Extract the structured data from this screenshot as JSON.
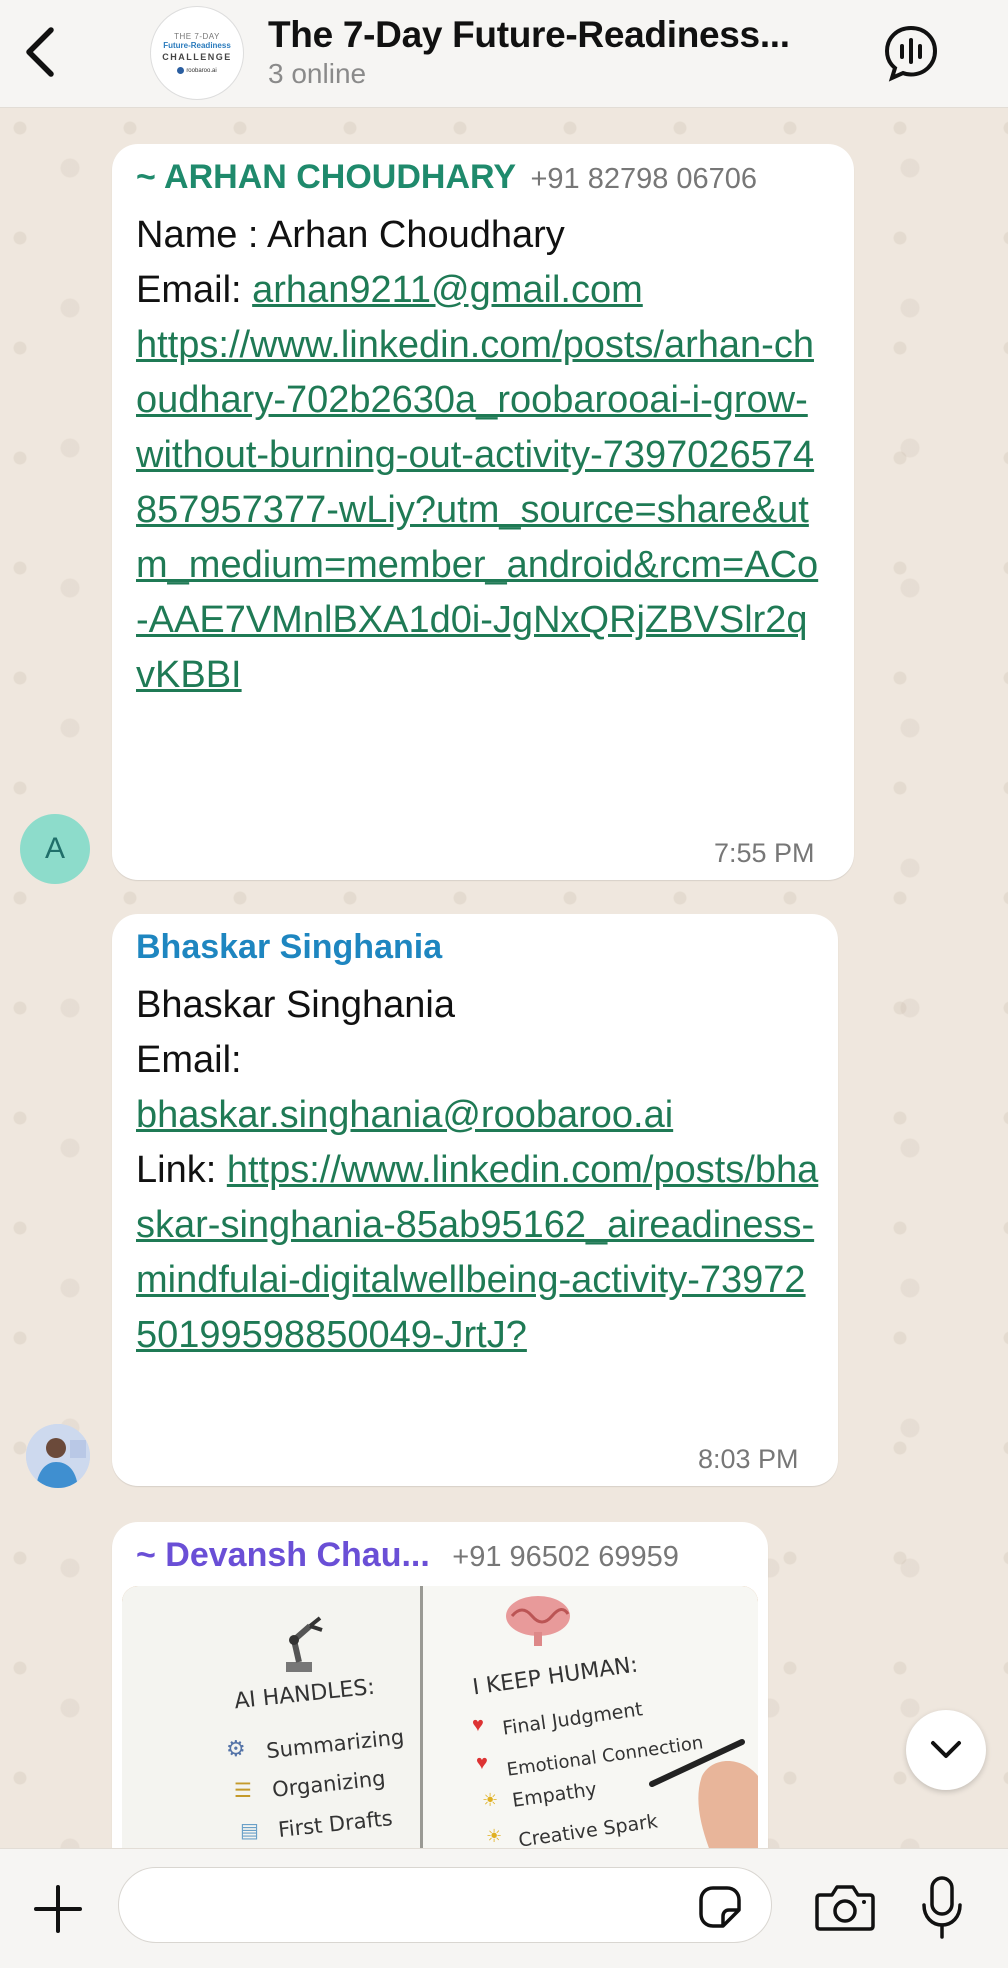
{
  "header": {
    "title": "The 7-Day Future-Readiness...",
    "subtitle": "3 online",
    "avatar_lines": [
      "THE 7-DAY",
      "Future-Readiness",
      "CHALLENGE",
      "roobaroo.ai"
    ]
  },
  "messages": [
    {
      "sender": "~ ARHAN CHOUDHARY",
      "sender_color": "#1f8a6c",
      "phone": "+91 82798 06706",
      "lines": {
        "name": "Name : Arhan Choudhary",
        "email_label": "Email: ",
        "email": "arhan9211@gmail.com",
        "link": "https://www.linkedin.com/posts/arhan-choudhary-702b2630a_roobarooai-i-grow-without-burning-out-activity-7397026574857957377-wLiy?utm_source=share&utm_medium=member_android&rcm=ACo-AAE7VMnlBXA1d0i-JgNxQRjZBVSlr2qvKBBI"
      },
      "time": "7:55 PM",
      "avatar_letter": "A"
    },
    {
      "sender": "Bhaskar Singhania",
      "sender_color": "#1e86c0",
      "lines": {
        "name": "Bhaskar Singhania",
        "email_label": "Email:",
        "email": "bhaskar.singhania@roobaroo.ai",
        "link_label": "Link: ",
        "link": "https://www.linkedin.com/posts/bhaskar-singhania-85ab95162_aireadiness-mindfulai-digitalwellbeing-activity-7397250199598850049-JrtJ?"
      },
      "time": "8:03 PM"
    },
    {
      "sender": "~ Devansh Chau...",
      "sender_color": "#6a4fd6",
      "phone": "+91 96502 69959",
      "image": {
        "left_heading": "AI HANDLES:",
        "left_items": [
          "Summarizing",
          "Organizing",
          "First Drafts"
        ],
        "right_heading": "I KEEP HUMAN:",
        "right_items": [
          "Final Judgment",
          "Emotional Connection",
          "Empathy",
          "Creative Spark"
        ]
      }
    }
  ],
  "input": {
    "placeholder": ""
  },
  "colors": {
    "link": "#1f7a55",
    "background": "#efe7de",
    "bubble": "#ffffff"
  }
}
